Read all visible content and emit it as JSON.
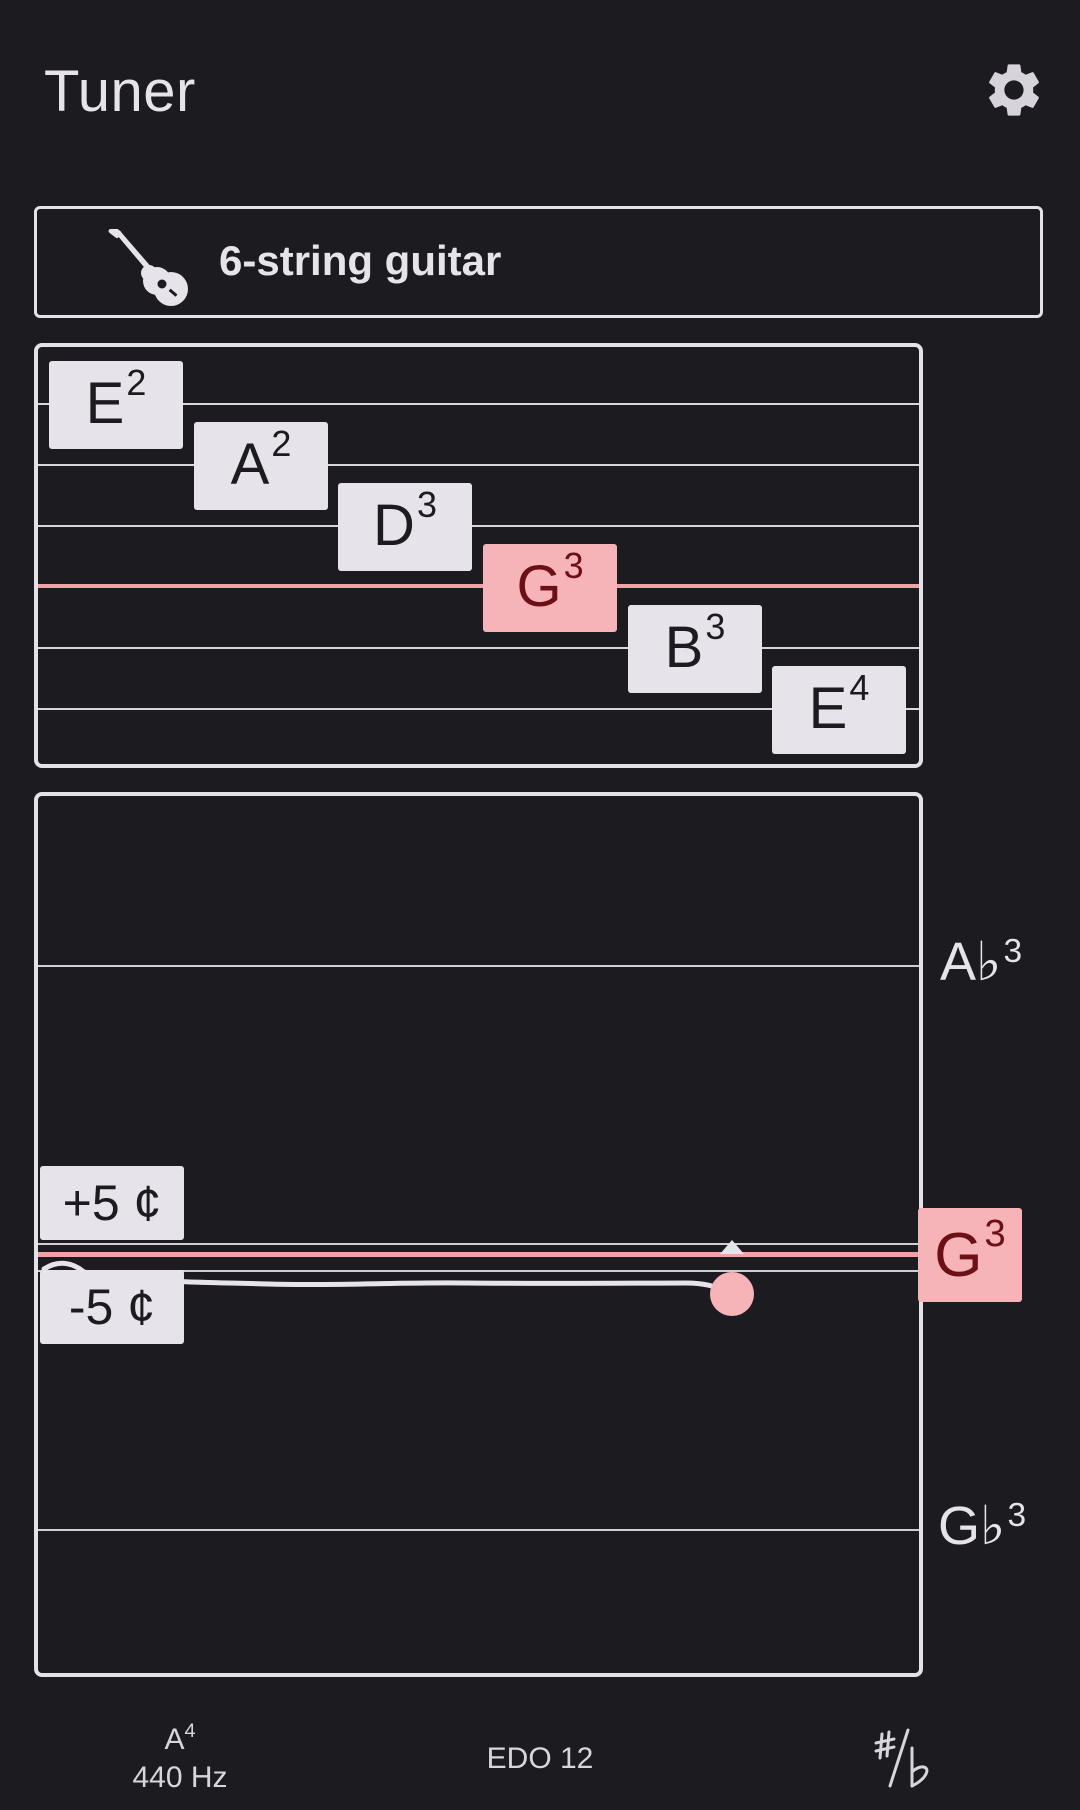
{
  "header": {
    "title": "Tuner",
    "settings_icon": "gear-icon"
  },
  "instrument": {
    "icon": "guitar-icon",
    "name": "6-string guitar"
  },
  "strings": [
    {
      "note": "E",
      "octave": "2",
      "active": false
    },
    {
      "note": "A",
      "octave": "2",
      "active": false
    },
    {
      "note": "D",
      "octave": "3",
      "active": false
    },
    {
      "note": "G",
      "octave": "3",
      "active": true
    },
    {
      "note": "B",
      "octave": "3",
      "active": false
    },
    {
      "note": "E",
      "octave": "4",
      "active": false
    }
  ],
  "pitch": {
    "tolerance_upper": "+5 ¢",
    "tolerance_lower": "-5 ¢",
    "upper_note": {
      "note": "A♭",
      "octave": "3"
    },
    "target_note": {
      "note": "G",
      "octave": "3"
    },
    "lower_note": {
      "note": "G♭",
      "octave": "3"
    }
  },
  "bottom_bar": {
    "reference_note": "A",
    "reference_octave": "4",
    "reference_frequency": "440 Hz",
    "temperament": "EDO 12",
    "notation_icon": "sharp-flat-icon"
  },
  "colors": {
    "background": "#1c1c20",
    "accent": "#f7b4b8",
    "accent_dark": "#6c0f17",
    "foreground": "#e6e4ea"
  }
}
